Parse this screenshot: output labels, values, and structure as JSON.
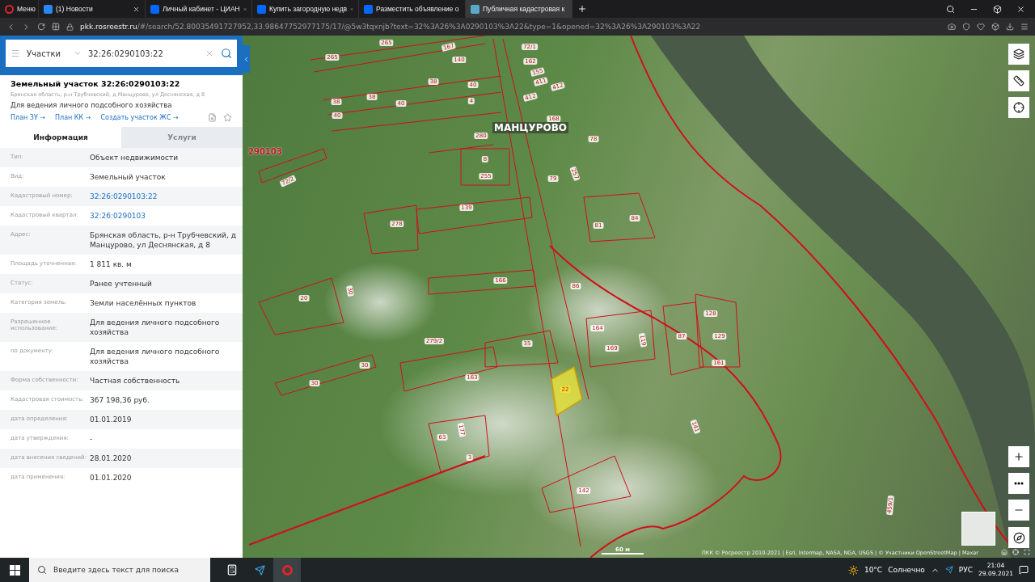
{
  "browser": {
    "tabs": [
      {
        "kind": "menu",
        "label": "Меню",
        "selected": false
      },
      {
        "kind": "vk",
        "label": "(1) Новости",
        "selected": false
      },
      {
        "kind": "cian",
        "label": "Личный кабинет - ЦИАН",
        "selected": false
      },
      {
        "kind": "cian",
        "label": "Купить загородную недв",
        "selected": false
      },
      {
        "kind": "cian",
        "label": "Разместить объявление о",
        "selected": false
      },
      {
        "kind": "pkk",
        "label": "Публичная кадастровая к",
        "selected": true
      }
    ],
    "url_host": "pkk.rosreestr.ru",
    "url_path": "/#/search/52.80035491727952,33.98647752977175/17/@5w3tqxnjb?text=32%3A26%3A0290103%3A22&type=1&opened=32%3A26%3A290103%3A22"
  },
  "panel": {
    "search": {
      "category": "Участки",
      "value": "32:26:0290103:22"
    },
    "object": {
      "title": "Земельный участок 32:26:0290103:22",
      "address": "Брянская область, р-н Трубчевский, д Манцурово, ул Деснянская, д 8",
      "purpose": "Для ведения личного подсобного хозяйства",
      "links": [
        "План ЗУ →",
        "План КК →",
        "Создать участок ЖС →"
      ]
    },
    "tabs": [
      {
        "label": "Информация",
        "selected": true
      },
      {
        "label": "Услуги",
        "selected": false
      }
    ],
    "rows": [
      {
        "label": "Тип:",
        "value": "Объект недвижимости",
        "kind": "text"
      },
      {
        "label": "Вид:",
        "value": "Земельный участок",
        "kind": "text"
      },
      {
        "label": "Кадастровый номер:",
        "value": "32:26:0290103:22",
        "kind": "link"
      },
      {
        "label": "Кадастровый квартал:",
        "value": "32:26:0290103",
        "kind": "link"
      },
      {
        "label": "Адрес:",
        "value": "Брянская область, р-н Трубчевский, д Манцурово, ул Деснянская, д 8",
        "kind": "text"
      },
      {
        "label": "Площадь уточненная:",
        "value": "1 811 кв. м",
        "kind": "text"
      },
      {
        "label": "Статус:",
        "value": "Ранее учтенный",
        "kind": "text"
      },
      {
        "label": "Категория земель:",
        "value": "Земли населённых пунктов",
        "kind": "text"
      },
      {
        "label": "Разрешенное использование:",
        "value": "Для ведения личного подсобного хозяйства",
        "kind": "text"
      },
      {
        "label": "по документу:",
        "value": "Для ведения личного подсобного хозяйства",
        "kind": "text"
      },
      {
        "label": "Форма собственности:",
        "value": "Частная собственность",
        "kind": "text"
      },
      {
        "label": "Кадастровая стоимость:",
        "value": "367 198,36 руб.",
        "kind": "text"
      },
      {
        "label": "дата определения:",
        "value": "01.01.2019",
        "kind": "text"
      },
      {
        "label": "дата утверждения:",
        "value": "-",
        "kind": "text"
      },
      {
        "label": "дата внесения сведений:",
        "value": "28.01.2020",
        "kind": "text"
      },
      {
        "label": "дата применения:",
        "value": "01.01.2020",
        "kind": "text"
      }
    ]
  },
  "map": {
    "settlement": "МАНЦУРОВО",
    "quarter": "290103",
    "scale": "60 м",
    "attribution": "ПКК © Росреестр 2010-2021 | Esri, Intermap, NASA, NGA, USGS | © Участники OpenStreetMap | Maxar",
    "parcels": [
      {
        "label": "265",
        "selected": false
      },
      {
        "label": "265",
        "selected": false
      },
      {
        "label": "167",
        "selected": false
      },
      {
        "label": "140",
        "selected": false
      },
      {
        "label": "72/1",
        "selected": false
      },
      {
        "label": "162",
        "selected": false
      },
      {
        "label": "155",
        "selected": false
      },
      {
        "label": "411",
        "selected": false
      },
      {
        "label": "412",
        "selected": false
      },
      {
        "label": "412",
        "selected": false
      },
      {
        "label": "38",
        "selected": false
      },
      {
        "label": "38",
        "selected": false
      },
      {
        "label": "38",
        "selected": false
      },
      {
        "label": "40",
        "selected": false
      },
      {
        "label": "40",
        "selected": false
      },
      {
        "label": "40",
        "selected": false
      },
      {
        "label": "4",
        "selected": false
      },
      {
        "label": "168",
        "selected": false
      },
      {
        "label": "280",
        "selected": false
      },
      {
        "label": "8",
        "selected": false
      },
      {
        "label": "255",
        "selected": false
      },
      {
        "label": "78",
        "selected": false
      },
      {
        "label": "79",
        "selected": false
      },
      {
        "label": "257",
        "selected": false
      },
      {
        "label": "72/2",
        "selected": false
      },
      {
        "label": "139",
        "selected": false
      },
      {
        "label": "278",
        "selected": false
      },
      {
        "label": "81",
        "selected": false
      },
      {
        "label": "84",
        "selected": false
      },
      {
        "label": "166",
        "selected": false
      },
      {
        "label": "86",
        "selected": false
      },
      {
        "label": "20",
        "selected": false
      },
      {
        "label": "30",
        "selected": false
      },
      {
        "label": "279/2",
        "selected": false
      },
      {
        "label": "35",
        "selected": false
      },
      {
        "label": "164",
        "selected": false
      },
      {
        "label": "169",
        "selected": false
      },
      {
        "label": "119",
        "selected": false
      },
      {
        "label": "87",
        "selected": false
      },
      {
        "label": "128",
        "selected": false
      },
      {
        "label": "129",
        "selected": false
      },
      {
        "label": "161",
        "selected": false
      },
      {
        "label": "30",
        "selected": false
      },
      {
        "label": "30",
        "selected": false
      },
      {
        "label": "163",
        "selected": false
      },
      {
        "label": "22",
        "selected": true
      },
      {
        "label": "63",
        "selected": false
      },
      {
        "label": "177",
        "selected": false
      },
      {
        "label": "3",
        "selected": false
      },
      {
        "label": "142",
        "selected": false
      },
      {
        "label": "141",
        "selected": false
      },
      {
        "label": "459/1",
        "selected": false
      }
    ]
  },
  "taskbar": {
    "search_placeholder": "Введите здесь текст для поиска",
    "temperature": "10°C",
    "weather": "Солнечно",
    "language": "РУС",
    "time": "21:04",
    "date": "29.09.2021"
  }
}
